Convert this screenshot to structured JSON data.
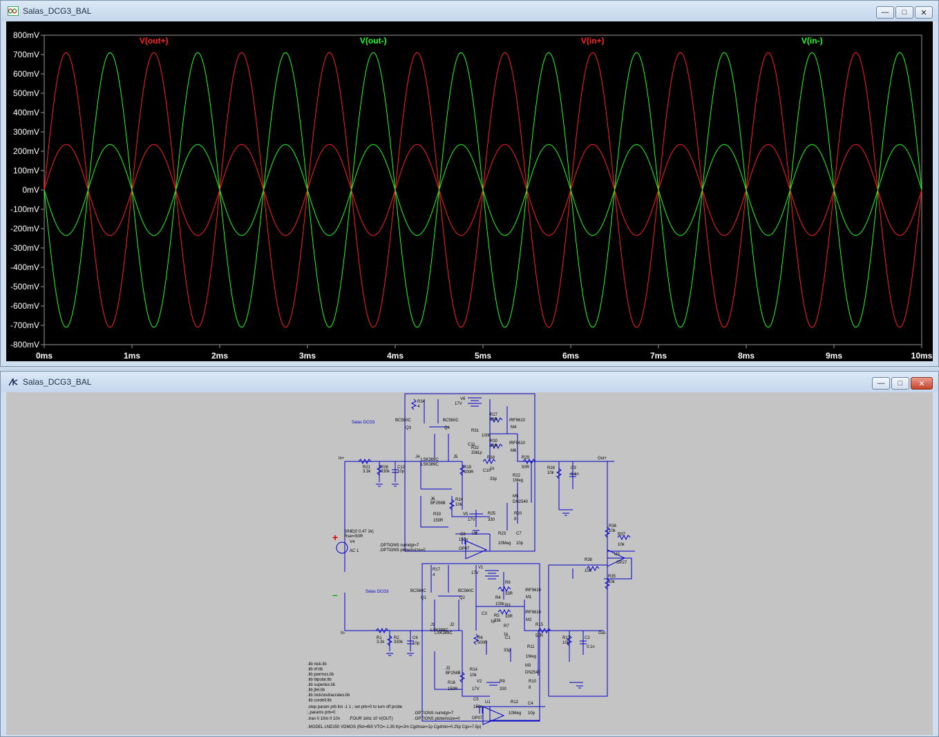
{
  "waveform_window": {
    "title": "Salas_DCG3_BAL",
    "controls": {
      "minimize": "—",
      "maximize": "□",
      "close": "✕"
    }
  },
  "schematic_window": {
    "title": "Salas_DCG3_BAL",
    "controls": {
      "minimize": "—",
      "maximize": "□",
      "close": "✕"
    }
  },
  "chart_data": {
    "type": "line",
    "title": "",
    "xlabel": "",
    "ylabel": "",
    "xlim": [
      0,
      10
    ],
    "ylim": [
      -800,
      800
    ],
    "x_unit": "ms",
    "y_unit": "mV",
    "x_ticks": [
      "0ms",
      "1ms",
      "2ms",
      "3ms",
      "4ms",
      "5ms",
      "6ms",
      "7ms",
      "8ms",
      "9ms",
      "10ms"
    ],
    "y_ticks": [
      "800mV",
      "700mV",
      "600mV",
      "500mV",
      "400mV",
      "300mV",
      "200mV",
      "100mV",
      "0mV",
      "-100mV",
      "-200mV",
      "-300mV",
      "-400mV",
      "-500mV",
      "-600mV",
      "-700mV",
      "-800mV"
    ],
    "background": "#000000",
    "grid": false,
    "series": [
      {
        "name": "V(out+)",
        "color": "#ff2020",
        "waveform": "sine",
        "frequency_khz": 1,
        "amplitude_mv": 710,
        "phase_deg": 0
      },
      {
        "name": "V(out-)",
        "color": "#20ff20",
        "waveform": "sine",
        "frequency_khz": 1,
        "amplitude_mv": 710,
        "phase_deg": 180
      },
      {
        "name": "V(in+)",
        "color": "#ff2020",
        "waveform": "sine",
        "frequency_khz": 1,
        "amplitude_mv": 235,
        "phase_deg": 0
      },
      {
        "name": "V(in-)",
        "color": "#20ff20",
        "waveform": "sine",
        "frequency_khz": 1,
        "amplitude_mv": 235,
        "phase_deg": 180
      }
    ]
  },
  "schematic": {
    "background": "#c4c4c4",
    "wire_color": "#0000c8",
    "top_section_label": "Salas DCG3",
    "bottom_section_label": "Salas DCG3",
    "plus_sign": "+",
    "minus_sign": "–",
    "labels_top": {
      "R34": "R34",
      "R34v": "4",
      "V6": "V6",
      "V6v": "17V",
      "R27": "R27",
      "R27v": "33R",
      "BC1": "BC560C",
      "BC2": "BC560C",
      "Q3": "Q3",
      "Q4": "Q4",
      "M4t": "IRF9610",
      "M4": "M4",
      "R31": "R31",
      "R31v": "100k",
      "R30": "R30",
      "R30v": "33R",
      "C11": "C11",
      "C11v": "1p",
      "R32": "R32",
      "R32v": "33k",
      "M6t": "IRF9610",
      "M6": "M6",
      "In+": "In+",
      "J4": "J4",
      "J4t": "LSK389C",
      "J5": "J5",
      "J5t": "LSK389C",
      "R18": "R18",
      "R18v": "1k",
      "R29": "R29",
      "R29v": "50R",
      "Out+": "Out+",
      "R21": "R21",
      "R21v": "3.3k",
      "R26": "R26",
      "R26v": "330k",
      "C12": "C12",
      "C12v": "10p",
      "R19": "R19",
      "R19v": "500R",
      "C10": "C10",
      "C10v": "33p",
      "R28": "R28",
      "R28v": "10k",
      "C9": "C9",
      "C9v": "0.1n",
      "R22": "R22",
      "R22v": "1Meg",
      "J6": "J6",
      "J6t": "BF256B",
      "R24": "R24",
      "R24v": "10k",
      "M5": "M5",
      "M5t": "DN2540",
      "V5": "V5",
      "V5v": "17V",
      "R25": "R25",
      "R25v": "330",
      "R20": "R20",
      "R20v": "8",
      "R33": "R33",
      "R33v": "150R",
      "R36": "R36",
      "R36v": "10k",
      "C8": "C8",
      "C8v": "150n",
      "U2": "U2",
      "R23": "R23",
      "R23v": "10Meg",
      "C7": "C7",
      "C7v": "10p",
      "R37": "R37",
      "R37v": "10k",
      "OP07a": "OP07"
    },
    "source": {
      "sine": "SINE(0 0.47 1k)",
      "rser": "Rser=50R",
      "name": "V4",
      "ac": "AC 1"
    },
    "options_top": [
      ".OPTIONS numdgt=7",
      ".OPTIONS plotwinsize=0"
    ],
    "labels_mid": {
      "R38": "R38",
      "R38v": "10k",
      "U3": "U3",
      "OP27": "OP27",
      "R35": "R35",
      "R35v": "10k"
    },
    "labels_bottom": {
      "R17": "R17",
      "R17v": "4",
      "V1": "V1",
      "V1v": "17V",
      "R8": "R8",
      "R8v": "33R",
      "M1t": "IRF9610",
      "M1": "M1",
      "BC1": "BC560C",
      "BC2": "BC560C",
      "Q1": "Q1",
      "Q2": "Q2",
      "R4": "R4",
      "R4v": "100k",
      "R3": "R3",
      "R3v": "33R",
      "M2t": "IRF9610",
      "M2": "M2",
      "C3": "C3",
      "C3v": "1p",
      "R5": "R5",
      "R5v": "33k",
      "R7": "R7",
      "R7v": "1k",
      "R15": "R15",
      "R15v": "50R",
      "In-": "In-",
      "Out-": "Out-",
      "J1": "J1",
      "J1t": "LSK389C",
      "J2": "J2",
      "J2t": "LSK389C",
      "R1": "R1",
      "R1v": "3.3k",
      "R2": "R2",
      "R2v": "330k",
      "C6": "C6",
      "C6v": "10p",
      "R6": "R6",
      "R6v": "500R",
      "C1": "C1",
      "C1v": "33p",
      "R13": "R13",
      "R13v": "10k",
      "C2": "C2",
      "C2v": "0.1n",
      "R11": "R11",
      "R11v": "1Meg",
      "J3": "J3",
      "J3t": "BF256B",
      "R14": "R14",
      "R14v": "10k",
      "M3": "M3",
      "M3t": "DN2540",
      "V2": "V2",
      "V2v": "17V",
      "R9": "R9",
      "R9v": "330",
      "R10": "R10",
      "R10v": "8",
      "R16": "R16",
      "R16v": "150R",
      "C5": "C5",
      "C5v": "150n",
      "U1": "U1",
      "R12": "R12",
      "R12v": "10Meg",
      "C4": "C4",
      "C4v": "10p",
      "OP07b": "OP07"
    },
    "libs": [
      ".lib nick.lib",
      ".lib irf.lib",
      ".lib pwrmos.lib",
      ".lib bipolar.lib",
      ".lib supertex.lib",
      ".lib jfet.lib",
      ".lib nick/ondracrates.lib",
      ".lib cordell.lib"
    ],
    "step_line": ".step param prb list -1 1 ; set prb=0 to turn off probe",
    "param_line": ";.params prb=0",
    "tran_line": ".tran 0 10m 0 10n",
    "four_line": ".FOUR 1khz 10 V(OUT)",
    "options_bottom": [
      ".OPTIONS numdgt=7",
      ".OPTIONS plotwinsize=0"
    ],
    "model_line": ".MODEL LND150 VDMOS (Rd=450 VTO=-1.35 Kp=2m Cgdmax=1p Cgdmin=0.25p Cgs=7.5p)"
  }
}
